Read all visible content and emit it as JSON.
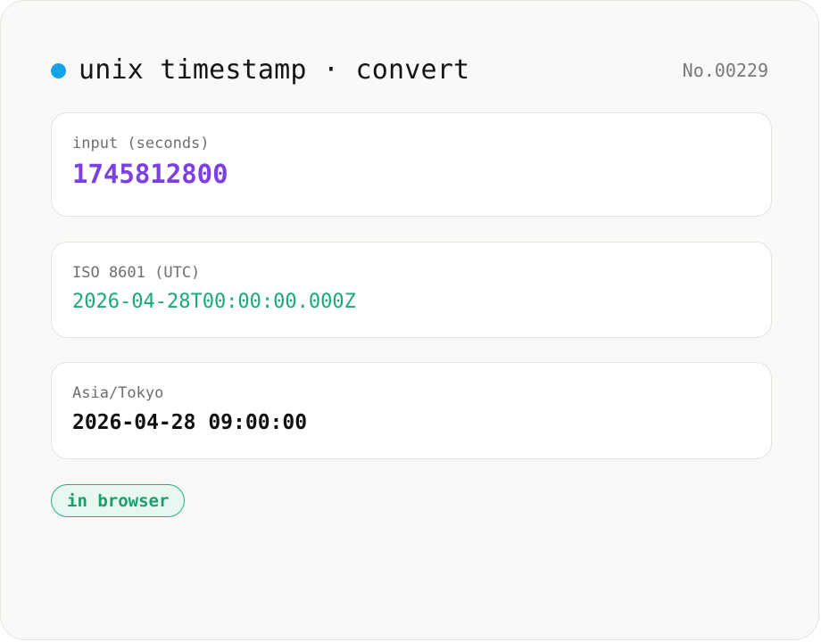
{
  "header": {
    "title": "unix timestamp · convert",
    "record_no": "No.00229",
    "status_color": "#15a3e8"
  },
  "fields": {
    "input": {
      "label": "input (seconds)",
      "value": "1745812800",
      "value_color": "#7c3fe4"
    },
    "iso": {
      "label": "ISO 8601 (UTC)",
      "value": "2026-04-28T00:00:00.000Z",
      "value_color": "#1aa879"
    },
    "timezone": {
      "label": "Asia/Tokyo",
      "value": "2026-04-28 09:00:00",
      "value_color": "#111111"
    }
  },
  "badge": {
    "label": "in browser",
    "color": "#17a06e"
  }
}
